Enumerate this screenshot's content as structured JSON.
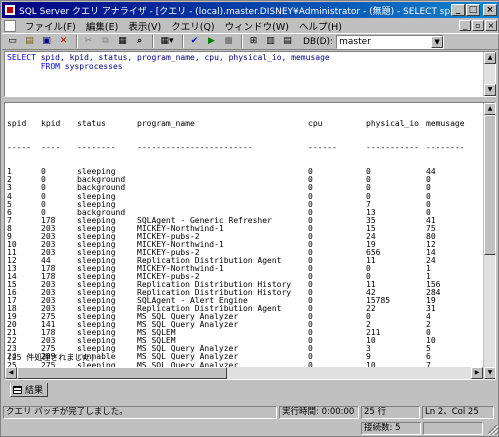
{
  "window": {
    "title": "SQL Server クエリ アナライザ - [クエリ - (local).master.DISNEY¥Administrator - (無題) - SELECT spid, kp..*]",
    "minimize": "_",
    "maximize": "□",
    "close": "×"
  },
  "menu": {
    "items": [
      "ファイル(F)",
      "編集(E)",
      "表示(V)",
      "クエリ(Q)",
      "ウィンドウ(W)",
      "ヘルプ(H)"
    ],
    "mdi_minimize": "_",
    "mdi_restore": "▫",
    "mdi_close": "×"
  },
  "toolbar": {
    "db_label": "DB(D):",
    "db_value": "master",
    "db_arrow": "▼",
    "icons": {
      "new_query": "▭",
      "open": "▤",
      "save": "▣",
      "delete": "✕",
      "cut": "✂",
      "copy": "⧉",
      "paste": "▦",
      "find": "⌕",
      "mode_menu": "▦▾",
      "parse": "✔",
      "execute": "▶",
      "stop": "■",
      "show_plan": "⊞",
      "object_browser": "▥",
      "object_search": "▤"
    }
  },
  "editor": {
    "line1_kw1": "SELECT",
    "line1_rest": " spid, kpid, status, program_name, cpu, physical_io, memusage",
    "line2_indent": "       ",
    "line2_kw": "FROM",
    "line2_rest": " sysprocesses"
  },
  "results": {
    "columns": [
      "spid",
      "kpid",
      "status",
      "program_name",
      "cpu",
      "physical_io",
      "memusage"
    ],
    "dashes": [
      "-----",
      "----",
      "--------",
      "------------------------",
      "------",
      "-----------",
      "--------"
    ],
    "rows": [
      [
        "1",
        "0",
        "sleeping",
        "",
        "0",
        "0",
        "44"
      ],
      [
        "2",
        "0",
        "background",
        "",
        "0",
        "0",
        "0"
      ],
      [
        "3",
        "0",
        "background",
        "",
        "0",
        "0",
        "0"
      ],
      [
        "4",
        "0",
        "sleeping",
        "",
        "0",
        "0",
        "0"
      ],
      [
        "5",
        "0",
        "sleeping",
        "",
        "0",
        "7",
        "0"
      ],
      [
        "6",
        "0",
        "background",
        "",
        "0",
        "13",
        "0"
      ],
      [
        "7",
        "178",
        "sleeping",
        "SQLAgent - Generic Refresher",
        "0",
        "35",
        "41"
      ],
      [
        "8",
        "203",
        "sleeping",
        "MICKEY-Northwind-1",
        "0",
        "15",
        "75"
      ],
      [
        "9",
        "203",
        "sleeping",
        "MICKEY-pubs-2",
        "0",
        "24",
        "80"
      ],
      [
        "10",
        "203",
        "sleeping",
        "MICKEY-Northwind-1",
        "0",
        "19",
        "12"
      ],
      [
        "11",
        "203",
        "sleeping",
        "MICKEY-pubs-2",
        "0",
        "656",
        "14"
      ],
      [
        "12",
        "44",
        "sleeping",
        "Replication Distribution Agent",
        "0",
        "11",
        "24"
      ],
      [
        "13",
        "178",
        "sleeping",
        "MICKEY-Northwind-1",
        "0",
        "0",
        "1"
      ],
      [
        "14",
        "178",
        "sleeping",
        "MICKEY-pubs-2",
        "0",
        "0",
        "1"
      ],
      [
        "15",
        "203",
        "sleeping",
        "Replication Distribution History",
        "0",
        "11",
        "156"
      ],
      [
        "16",
        "203",
        "sleeping",
        "Replication Distribution History",
        "0",
        "42",
        "284"
      ],
      [
        "17",
        "203",
        "sleeping",
        "SQLAgent - Alert Engine",
        "0",
        "15785",
        "19"
      ],
      [
        "18",
        "203",
        "sleeping",
        "Replication Distribution Agent",
        "0",
        "22",
        "31"
      ],
      [
        "19",
        "275",
        "sleeping",
        "MS SQL Query Analyzer",
        "0",
        "0",
        "4"
      ],
      [
        "20",
        "141",
        "sleeping",
        "MS SQL Query Analyzer",
        "0",
        "2",
        "2"
      ],
      [
        "21",
        "178",
        "sleeping",
        "MS SQLEM",
        "0",
        "211",
        "0"
      ],
      [
        "22",
        "203",
        "sleeping",
        "MS SQLEM",
        "0",
        "10",
        "10"
      ],
      [
        "23",
        "275",
        "sleeping",
        "MS SQL Query Analyzer",
        "0",
        "3",
        "5"
      ],
      [
        "24",
        "209",
        "runnable",
        "MS SQL Query Analyzer",
        "0",
        "9",
        "6"
      ],
      [
        "25",
        "275",
        "sleeping",
        "MS SQL Query Analyzer",
        "0",
        "10",
        "7"
      ]
    ],
    "footer": "(25 件処理されました)"
  },
  "tabs": {
    "results_label": "結果"
  },
  "status": {
    "message": "クエリ バッチが完了しました。",
    "exec_time": "実行時間: 0:00:00",
    "row_count": "25 行",
    "position": "Ln 2、Col 25",
    "connections": "接続数: 5"
  }
}
